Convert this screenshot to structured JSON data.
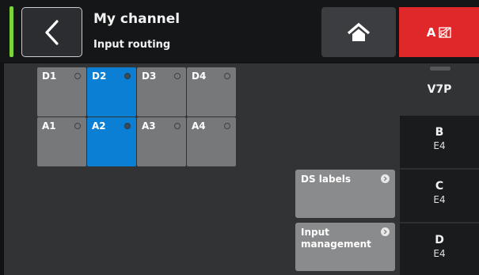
{
  "header": {
    "title": "My channel",
    "subtitle": "Input routing",
    "mute_label": "A"
  },
  "icons": {
    "back": "chevron-left-icon",
    "home": "home-icon",
    "mute": "speaker-muted-icon",
    "arrow": "arrow-right-circle-icon"
  },
  "colors": {
    "level_meter": "#7cd43b",
    "selected_cell": "#0a7fd4",
    "mute_button": "#e0282b"
  },
  "grid": {
    "digital": [
      {
        "label": "D1",
        "selected": false
      },
      {
        "label": "D2",
        "selected": true
      },
      {
        "label": "D3",
        "selected": false
      },
      {
        "label": "D4",
        "selected": false
      }
    ],
    "analog": [
      {
        "label": "A1",
        "selected": false
      },
      {
        "label": "A2",
        "selected": true
      },
      {
        "label": "A3",
        "selected": false
      },
      {
        "label": "A4",
        "selected": false
      }
    ]
  },
  "buttons": {
    "ds_labels": "DS labels",
    "input_management_line1": "Input",
    "input_management_line2": "management"
  },
  "tabs": [
    {
      "title": "V7P",
      "sub": ""
    },
    {
      "title": "B",
      "sub": "E4"
    },
    {
      "title": "C",
      "sub": "E4"
    },
    {
      "title": "D",
      "sub": "E4"
    }
  ]
}
